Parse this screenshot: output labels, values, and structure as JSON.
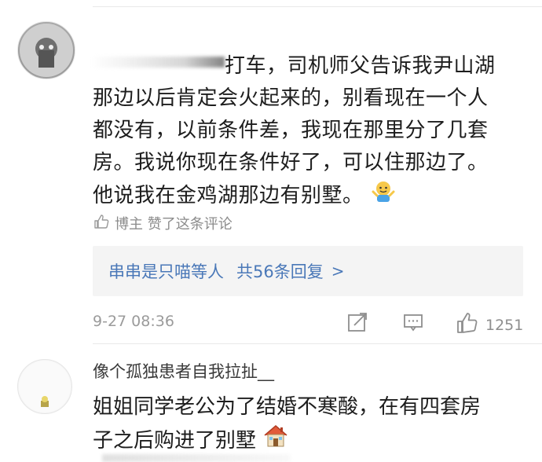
{
  "comment1": {
    "text_line1_after_name": "打车，司机师父告诉我尹山湖",
    "text_lines": [
      "那边以后肯定会火起来的，别看现在一个人",
      "都没有，以前条件差，我现在那里分了几套",
      "房。我说你现在条件好了，可以住那边了。",
      "他说我在金鸡湖那边有别墅。"
    ],
    "emoji_icon": "shrug-person-emoji",
    "liked_by_author": "博主 赞了这条评论",
    "replies_box": {
      "users": "串串是只喵等人",
      "count": "共56条回复",
      "chevron": ">"
    },
    "time": "9-27 08:36",
    "like_count": "1251"
  },
  "comment2": {
    "username": "像个孤独患者自我拉扯__",
    "text_lines": [
      "姐姐同学老公为了结婚不寒酸，在有四套房",
      "子之后购进了别墅"
    ],
    "emoji_icon": "house-emoji"
  }
}
